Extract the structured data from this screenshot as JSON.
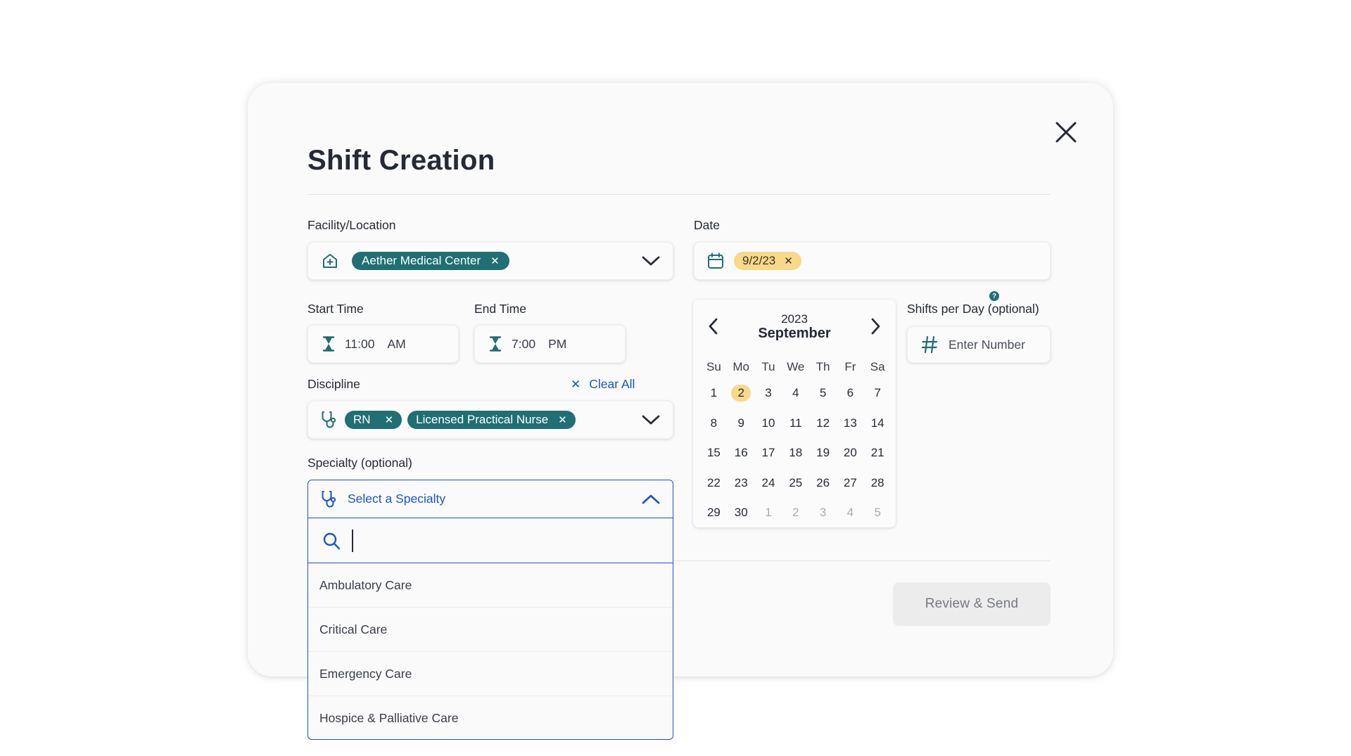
{
  "modal": {
    "title": "Shift Creation",
    "review_button": "Review & Send"
  },
  "facility": {
    "label": "Facility/Location",
    "chip": "Aether Medical Center"
  },
  "date": {
    "label": "Date",
    "chip": "9/2/23"
  },
  "start_time": {
    "label": "Start Time",
    "value": "11:00",
    "ampm": "AM"
  },
  "end_time": {
    "label": "End Time",
    "value": "7:00",
    "ampm": "PM"
  },
  "shifts_per_day": {
    "label": "Shifts per Day (optional)",
    "placeholder": "Enter Number",
    "help": "?"
  },
  "discipline": {
    "label": "Discipline",
    "clear_all": "Clear All",
    "chips": [
      "RN",
      "Licensed Practical Nurse"
    ]
  },
  "specialty": {
    "label": "Specialty (optional)",
    "placeholder": "Select a Specialty",
    "options": [
      "Ambulatory Care",
      "Critical Care",
      "Emergency Care",
      "Hospice & Palliative Care"
    ]
  },
  "calendar": {
    "year": "2023",
    "month": "September",
    "weekdays": [
      "Su",
      "Mo",
      "Tu",
      "We",
      "Th",
      "Fr",
      "Sa"
    ],
    "selected_day": 2,
    "days": [
      "1",
      "2",
      "3",
      "4",
      "5",
      "6",
      "7",
      "8",
      "9",
      "10",
      "11",
      "12",
      "13",
      "14",
      "15",
      "16",
      "17",
      "18",
      "19",
      "20",
      "21",
      "22",
      "23",
      "24",
      "25",
      "26",
      "27",
      "28",
      "29",
      "30"
    ],
    "next_month_days": [
      "1",
      "2",
      "3",
      "4",
      "5"
    ]
  },
  "colors": {
    "teal": "#1f6f73",
    "blue": "#1856c9",
    "date_chip": "#f8d98a"
  },
  "icons": {
    "close": "close-icon",
    "facility": "home-plus-icon",
    "date": "calendar-icon",
    "time": "hourglass-icon",
    "number": "hash-icon",
    "discipline": "stethoscope-icon",
    "search": "search-icon"
  }
}
